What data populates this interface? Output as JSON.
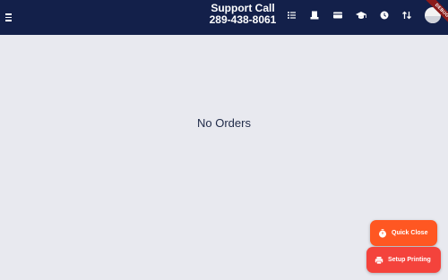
{
  "header": {
    "title": "Support Call",
    "phone": "289-438-8061",
    "debug_banner": "DEBUG",
    "icons": [
      "list-icon",
      "printer-icon",
      "credit-card-icon",
      "graduation-cap-icon",
      "clock-icon",
      "sort-icon"
    ]
  },
  "main": {
    "empty_message": "No Orders"
  },
  "actions": {
    "quick_close_label": "Quick Close",
    "setup_printing_label": "Setup Printing"
  },
  "colors": {
    "header_bg": "#13204a",
    "page_bg": "#e8e9ef",
    "quick_close_bg": "#ff5722",
    "setup_printing_bg": "#f4433c"
  }
}
